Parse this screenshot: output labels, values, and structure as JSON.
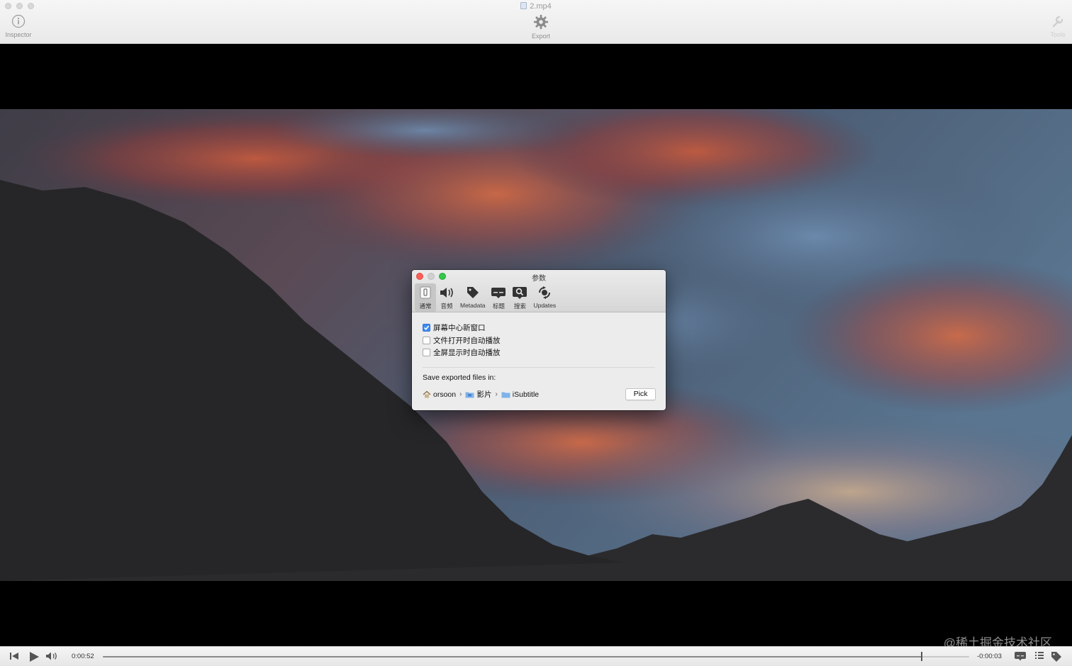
{
  "window": {
    "title": "2.mp4"
  },
  "toolbar": {
    "inspector_label": "Inspector",
    "export_label": "Export",
    "tools_label": "Tools"
  },
  "preferences": {
    "title": "参数",
    "tabs": [
      {
        "label": "通常",
        "icon": "switch-icon",
        "active": true
      },
      {
        "label": "音频",
        "icon": "speaker-icon",
        "active": false
      },
      {
        "label": "Metadata",
        "icon": "tag-icon",
        "active": false
      },
      {
        "label": "标题",
        "icon": "subtitle-icon",
        "active": false
      },
      {
        "label": "搜索",
        "icon": "search-icon",
        "active": false
      },
      {
        "label": "Updates",
        "icon": "refresh-icon",
        "active": false
      }
    ],
    "options": [
      {
        "label": "屏幕中心新窗口",
        "checked": true
      },
      {
        "label": "文件打开时自动播放",
        "checked": false
      },
      {
        "label": "全屏显示时自动播放",
        "checked": false
      }
    ],
    "save_label": "Save exported files in:",
    "path": [
      {
        "label": "orsoon",
        "icon": "home-icon"
      },
      {
        "label": "影片",
        "icon": "folder-icon"
      },
      {
        "label": "iSubtitle",
        "icon": "folder-icon"
      }
    ],
    "pick_label": "Pick"
  },
  "player": {
    "elapsed": "0:00:52",
    "remaining": "-0:00:03",
    "progress": 0.945
  },
  "overlay": {
    "corner_watermark": "@稀土掘金技术社区"
  },
  "colors": {
    "accent": "#3d8cf2",
    "close": "#fc5f57",
    "zoom": "#34c84a"
  }
}
